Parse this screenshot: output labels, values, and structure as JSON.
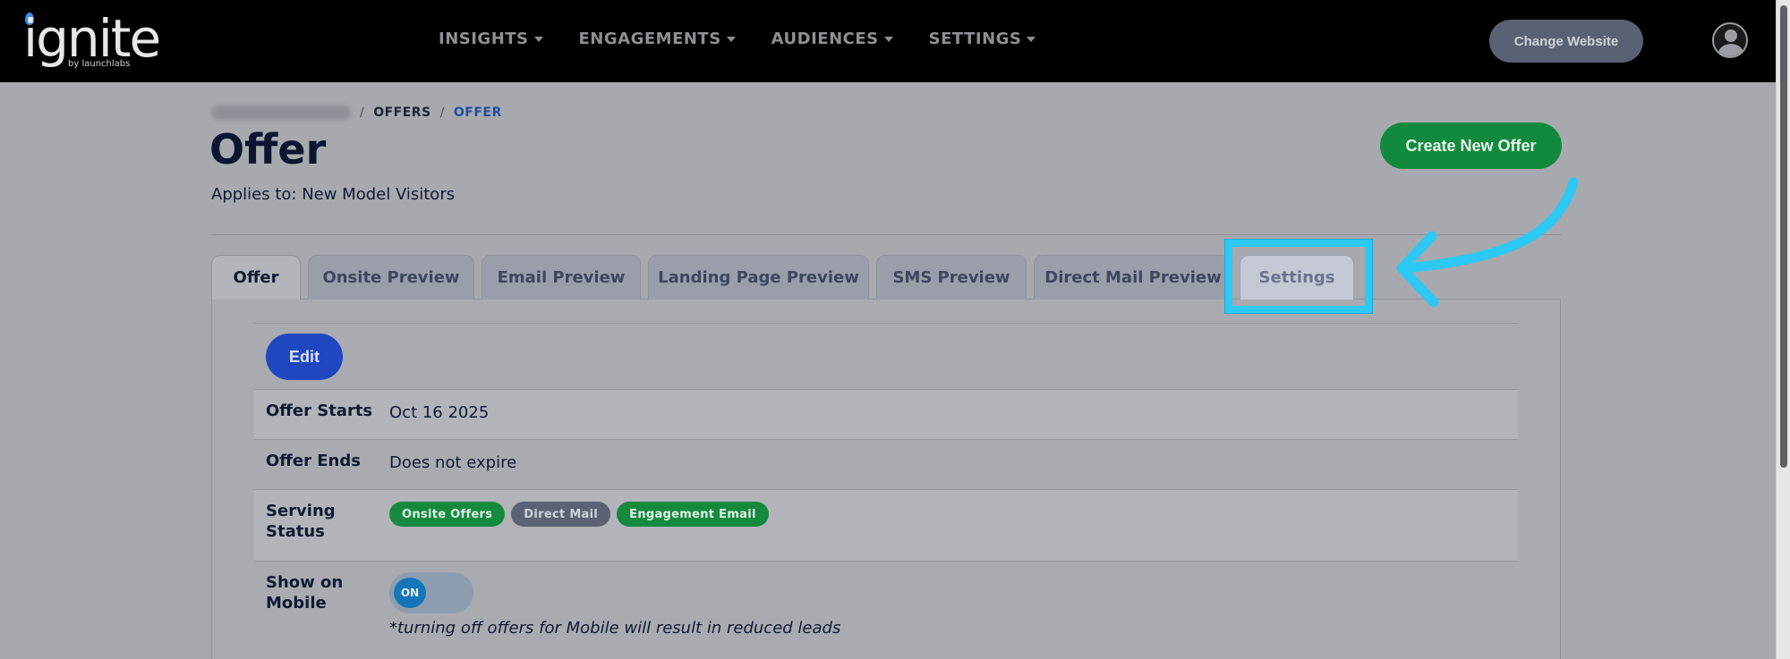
{
  "topbar": {
    "logo_text": "ignite",
    "logo_sub": "by launchlabs",
    "nav": [
      {
        "label": "INSIGHTS"
      },
      {
        "label": "ENGAGEMENTS"
      },
      {
        "label": "AUDIENCES"
      },
      {
        "label": "SETTINGS"
      }
    ],
    "change_website": "Change Website",
    "avatar_icon": "user-circle-icon"
  },
  "breadcrumb": {
    "sep1": "/",
    "offers": "OFFERS",
    "sep2": "/",
    "offer": "OFFER"
  },
  "header": {
    "title": "Offer",
    "applies_to": "Applies to: New Model Visitors",
    "create_button": "Create New Offer"
  },
  "tabs": [
    {
      "label": "Offer",
      "active": true
    },
    {
      "label": "Onsite Preview"
    },
    {
      "label": "Email Preview"
    },
    {
      "label": "Landing Page Preview"
    },
    {
      "label": "SMS Preview"
    },
    {
      "label": "Direct Mail Preview"
    },
    {
      "label": "Settings",
      "highlighted": true
    }
  ],
  "panel": {
    "edit_button": "Edit",
    "rows": [
      {
        "label": "Offer Starts",
        "value": "Oct 16 2025"
      },
      {
        "label": "Offer Ends",
        "value": "Does not expire"
      },
      {
        "label": "Serving Status",
        "badges": [
          {
            "label": "Onsite Offers",
            "color": "#158a3e"
          },
          {
            "label": "Direct Mail",
            "color": "#5c6274"
          },
          {
            "label": "Engagement Email",
            "color": "#158a3e"
          }
        ]
      },
      {
        "label": "Show on Mobile",
        "toggle": "ON",
        "note": "*turning off offers for Mobile will result in reduced leads"
      }
    ]
  },
  "annotation": {
    "highlight_color": "#2ec8f4",
    "arrow_icon": "curved-arrow-icon"
  }
}
